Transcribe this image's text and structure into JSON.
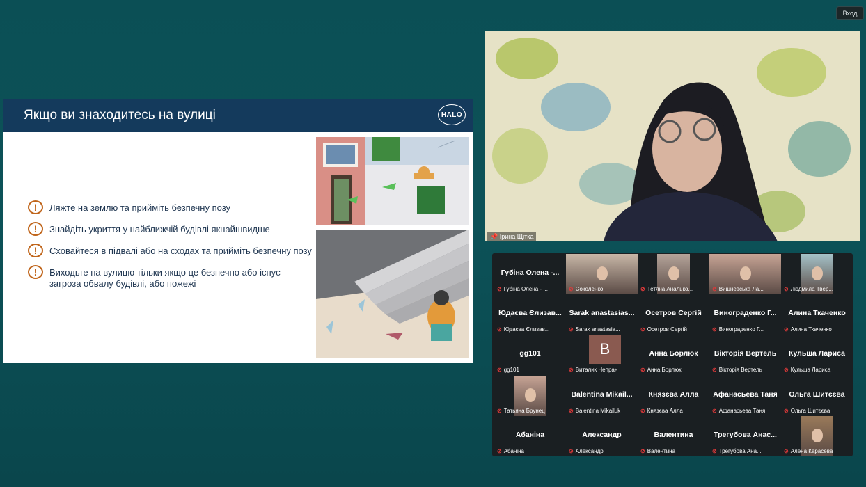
{
  "top_right": {
    "exit_label": "Вхoд"
  },
  "slide": {
    "title": "Якщо ви знаходитесь на вулиці",
    "logo_text": "HALO",
    "bullets": [
      "Ляжте на землю та прийміть безпечну позу",
      "Знайдіть укриття у найближчій будівлі якнайшвидше",
      "Сховайтеся в підвалі або на сходах та прийміть безпечну позу",
      "Виходьте на вулицю тільки якщо це безпечно або існує загроза обвалу будівлі, або пожежі"
    ]
  },
  "speaker": {
    "name": "Ірина Щітка"
  },
  "participants": [
    {
      "name": "Губіна Олена -...",
      "label": "Губіна Олена - ...",
      "video": false
    },
    {
      "name": "",
      "label": "Соколенко",
      "video": true
    },
    {
      "name": "",
      "label": "Тетяна Аналько...",
      "video": true
    },
    {
      "name": "",
      "label": "Вишневська Ла...",
      "video": true
    },
    {
      "name": "",
      "label": "Людмила Твер...",
      "video": true
    },
    {
      "name": "Юдаєва Єлизав...",
      "label": "Юдаєва Єлизав...",
      "video": false
    },
    {
      "name": "Sarak anastasias...",
      "label": "Sarak anastasia...",
      "video": false
    },
    {
      "name": "Осетров Сергій",
      "label": "Осетров Сергій",
      "video": false
    },
    {
      "name": "Винограденко Г...",
      "label": "Винограденко Г...",
      "video": false
    },
    {
      "name": "Алина Ткаченко",
      "label": "Алина Ткаченко",
      "video": false
    },
    {
      "name": "gg101",
      "label": "gg101",
      "video": false
    },
    {
      "name": "B",
      "label": "Виталик Непран",
      "video": false
    },
    {
      "name": "Анна Борлюк",
      "label": "Анна Борлюк",
      "video": false
    },
    {
      "name": "Вікторія Вертель",
      "label": "Вікторія Вертель",
      "video": false
    },
    {
      "name": "Кульша Лариса",
      "label": "Кульша Лариса",
      "video": false
    },
    {
      "name": "",
      "label": "Татьяна Брунец",
      "video": true
    },
    {
      "name": "Balentina Mikail...",
      "label": "Balentina Mikailuk",
      "video": false
    },
    {
      "name": "Князєва Алла",
      "label": "Князєва Алла",
      "video": false
    },
    {
      "name": "Афанасьева Таня",
      "label": "Афанасьева Таня",
      "video": false
    },
    {
      "name": "Ольга Шитєєва",
      "label": "Ольга Шитєєва",
      "video": false
    },
    {
      "name": "Абаніна",
      "label": "Абаніна",
      "video": false
    },
    {
      "name": "Александр",
      "label": "Александр",
      "video": false
    },
    {
      "name": "Валентина",
      "label": "Валентина",
      "video": false
    },
    {
      "name": "Трегубова Анас...",
      "label": "Трегубова Ана...",
      "video": false
    },
    {
      "name": "",
      "label": "Алёна Карасёва",
      "video": true
    }
  ],
  "colors": {
    "background": "#0b4f55",
    "slide_header": "#143a5c",
    "warning": "#c0651b",
    "muted_mic": "#e23a3a"
  }
}
